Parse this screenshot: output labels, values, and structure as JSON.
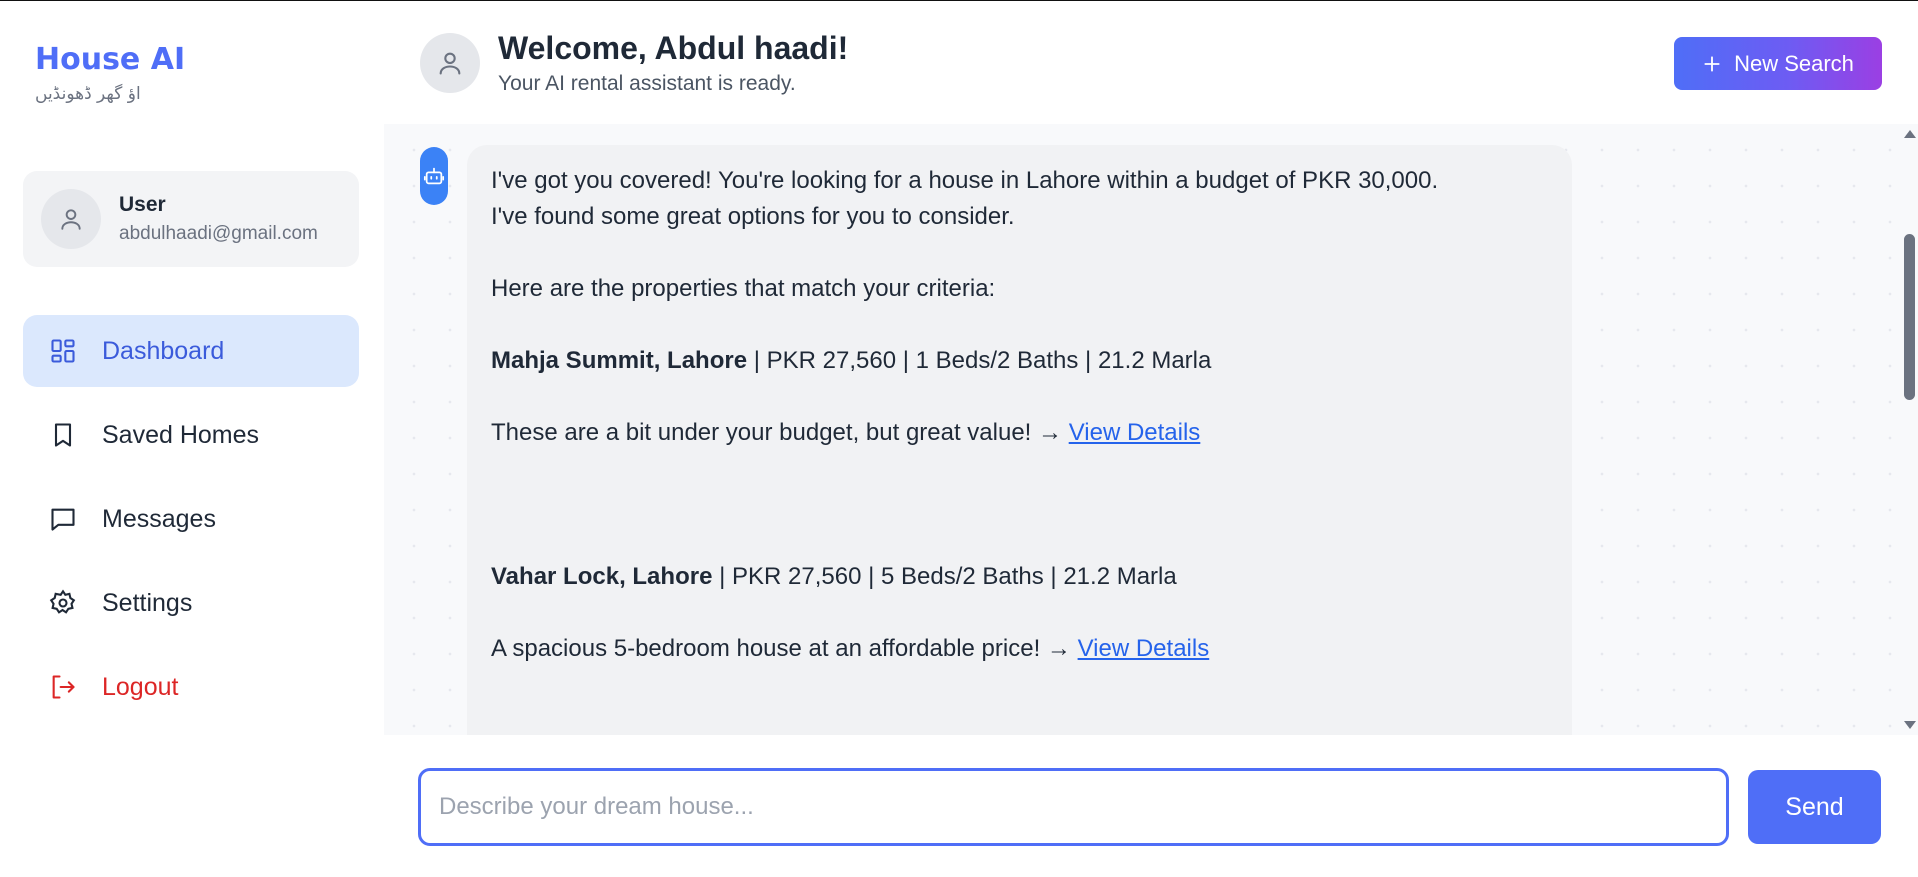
{
  "brand": {
    "title": "House AI",
    "tagline": "اؤ گھر ڈھونڈیں"
  },
  "user": {
    "name": "User",
    "email": "abdulhaadi@gmail.com"
  },
  "nav": {
    "items": [
      {
        "label": "Dashboard",
        "icon": "dashboard-icon",
        "active": true
      },
      {
        "label": "Saved Homes",
        "icon": "bookmark-icon"
      },
      {
        "label": "Messages",
        "icon": "message-icon"
      },
      {
        "label": "Settings",
        "icon": "gear-icon"
      },
      {
        "label": "Logout",
        "icon": "logout-icon"
      }
    ]
  },
  "header": {
    "welcome": "Welcome, Abdul haadi!",
    "subtitle": "Your AI rental assistant is ready.",
    "new_search_label": "New Search"
  },
  "chat": {
    "bot_message": {
      "intro_line1": "I've got you covered! You're looking for a house in Lahore within a budget of PKR 30,000.",
      "intro_line2": "I've found some great options for you to consider.",
      "criteria": "Here are the properties that match your criteria:",
      "property1": {
        "name": "Mahja Summit, Lahore",
        "details": " | PKR 27,560 | 1 Beds/2 Baths | 21.2 Marla",
        "note": "These are a bit under your budget, but great value! → ",
        "link": "View Details"
      },
      "property2": {
        "name": "Vahar Lock, Lahore",
        "details": " | PKR 27,560 | 5 Beds/2 Baths | 21.2 Marla",
        "note": "A spacious 5-bedroom house at an affordable price! → ",
        "link": "View Details"
      }
    }
  },
  "composer": {
    "placeholder": "Describe your dream house...",
    "send_label": "Send"
  },
  "colors": {
    "accent": "#4f6ef7",
    "active_bg": "#dbe8fd",
    "logout": "#dc2626",
    "link": "#2563eb"
  }
}
